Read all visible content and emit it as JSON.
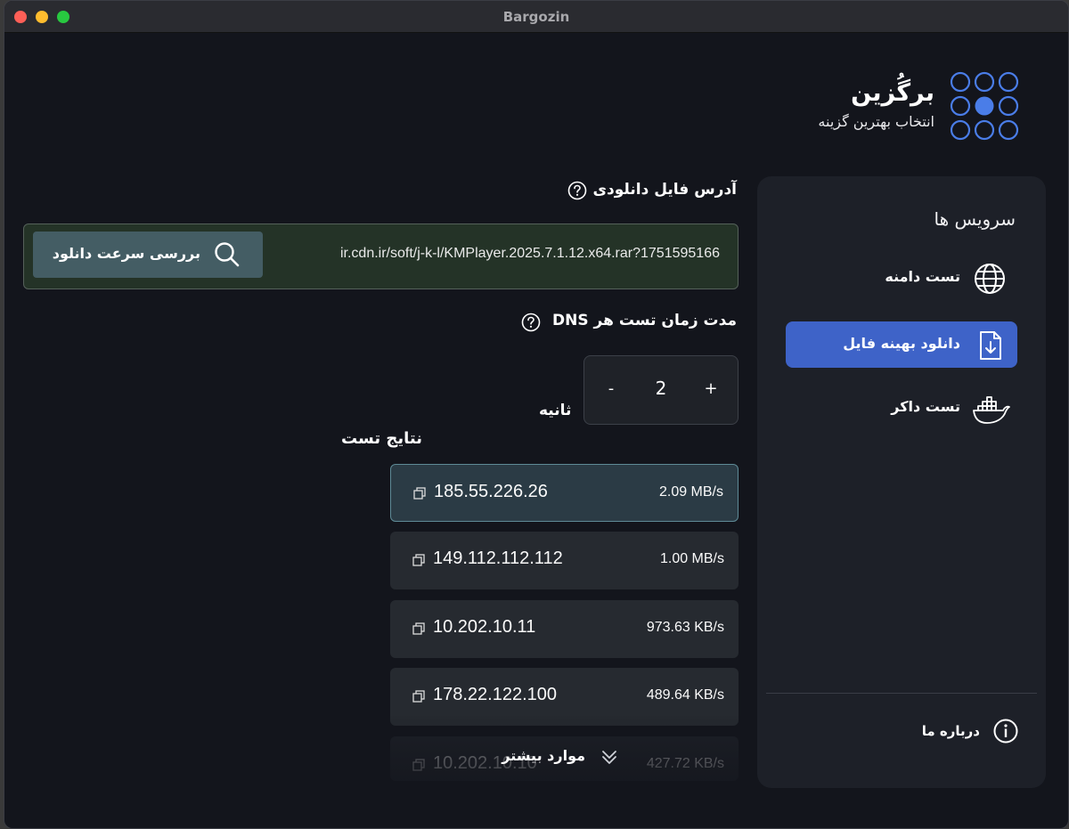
{
  "window": {
    "title": "Bargozin"
  },
  "brand": {
    "name": "برگُزین",
    "tagline": "انتخاب بهترین گزینه"
  },
  "sidebar": {
    "title": "سرویس ها",
    "items": [
      {
        "label": "تست دامنه",
        "icon": "globe-icon",
        "active": false
      },
      {
        "label": "دانلود بهینه فایل",
        "icon": "file-download-icon",
        "active": true
      },
      {
        "label": "تست داکر",
        "icon": "docker-icon",
        "active": false
      }
    ],
    "about": {
      "label": "درباره ما",
      "icon": "info-icon"
    }
  },
  "download": {
    "label": "آدرس فایل دانلودی",
    "url": "ir.cdn.ir/soft/j-k-l/KMPlayer.2025.7.1.12.x64.rar?1751595166",
    "button_label": "بررسی سرعت دانلود"
  },
  "dns": {
    "label": "مدت زمان تست هر DNS",
    "value": "2",
    "plus": "+",
    "minus": "-",
    "unit": "ثانیه"
  },
  "results": {
    "title": "نتایج تست",
    "rows": [
      {
        "ip": "185.55.226.26",
        "speed": "2.09 MB/s",
        "best": true
      },
      {
        "ip": "149.112.112.112",
        "speed": "1.00 MB/s",
        "best": false
      },
      {
        "ip": "10.202.10.11",
        "speed": "973.63 KB/s",
        "best": false
      },
      {
        "ip": "178.22.122.100",
        "speed": "489.64 KB/s",
        "best": false
      },
      {
        "ip": "10.202.10.10",
        "speed": "427.72 KB/s",
        "best": false
      }
    ],
    "more_label": "موارد بیشتر"
  },
  "colors": {
    "accent": "#3e63c8",
    "best_border": "#5e8a96",
    "logo": "#4a7de8"
  }
}
